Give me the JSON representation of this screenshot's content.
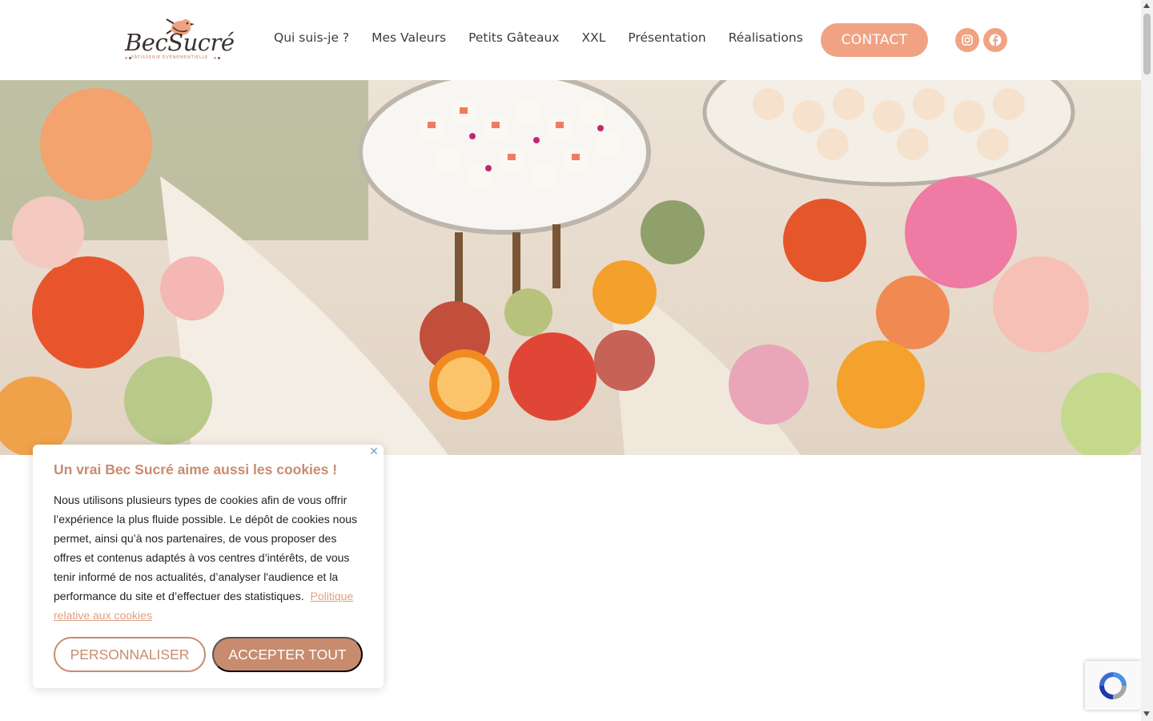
{
  "brand": {
    "name": "BecSucré",
    "tagline": "PÂTISSERIE ÉVÉNEMENTIELLE",
    "accent": "#f0a283",
    "accent_dark": "#c98b6e"
  },
  "nav": {
    "items": [
      {
        "label": "Qui suis-je ?"
      },
      {
        "label": "Mes Valeurs"
      },
      {
        "label": "Petits Gâteaux"
      },
      {
        "label": "XXL"
      },
      {
        "label": "Présentation"
      },
      {
        "label": "Réalisations"
      }
    ],
    "contact_label": "CONTACT",
    "social": [
      {
        "icon": "instagram-icon"
      },
      {
        "icon": "facebook-icon"
      }
    ]
  },
  "hero": {
    "image": "dessert-table-with-flowers"
  },
  "cookie_banner": {
    "title": "Un vrai Bec Sucré aime aussi les cookies !",
    "body": "Nous utilisons plusieurs types de cookies afin de vous offrir l’expérience la plus fluide possible. Le dépôt de cookies nous permet, ainsi qu’à nos partenaires, de vous proposer des offres et contenus adaptés à vos centres d’intérêts, de vous tenir informé de nos actualités, d’analyser l'audience et la performance du site et d’effectuer des statistiques.",
    "policy_link": "Politique relative aux cookies",
    "customize_label": "PERSONNALISER",
    "accept_label": "ACCEPTER TOUT",
    "close_icon": "close-icon"
  },
  "recaptcha": {
    "icon": "recaptcha-icon"
  }
}
